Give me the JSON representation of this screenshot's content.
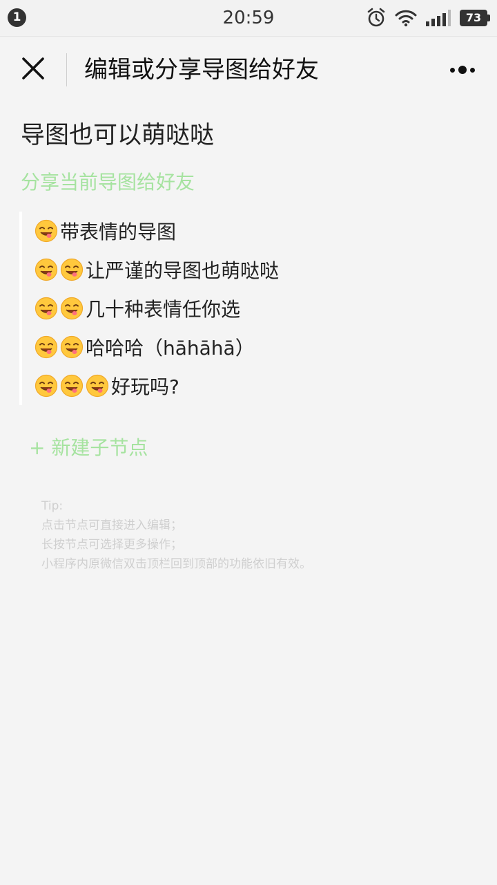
{
  "status_bar": {
    "notification_count": "1",
    "time": "20:59",
    "battery_level": "73",
    "icons": [
      "alarm-icon",
      "wifi-icon",
      "signal-icon",
      "battery-icon"
    ]
  },
  "nav_bar": {
    "title": "编辑或分享导图给好友",
    "close_icon": "close-icon",
    "more_icon": "more-dots-icon"
  },
  "main": {
    "title": "导图也可以萌哒哒",
    "share_link": "分享当前导图给好友",
    "nodes": [
      {
        "emoji_count": 1,
        "text": "带表情的导图"
      },
      {
        "emoji_count": 2,
        "text": "让严谨的导图也萌哒哒"
      },
      {
        "emoji_count": 2,
        "text": "几十种表情任你选"
      },
      {
        "emoji_count": 2,
        "text": "哈哈哈（hāhāhā）"
      },
      {
        "emoji_count": 3,
        "text": "好玩吗?"
      }
    ],
    "new_node_label": "+ 新建子节点",
    "tips": {
      "heading": "Tip:",
      "line1": "点击节点可直接进入编辑；",
      "line2": "长按节点可选择更多操作；",
      "line3": "小程序内原微信双击顶栏回到顶部的功能依旧有效。"
    }
  },
  "colors": {
    "accent_green": "#a6e3a0",
    "background": "#f4f4f4",
    "node_border": "#ffffff",
    "tip_text": "#cfcfcf"
  }
}
